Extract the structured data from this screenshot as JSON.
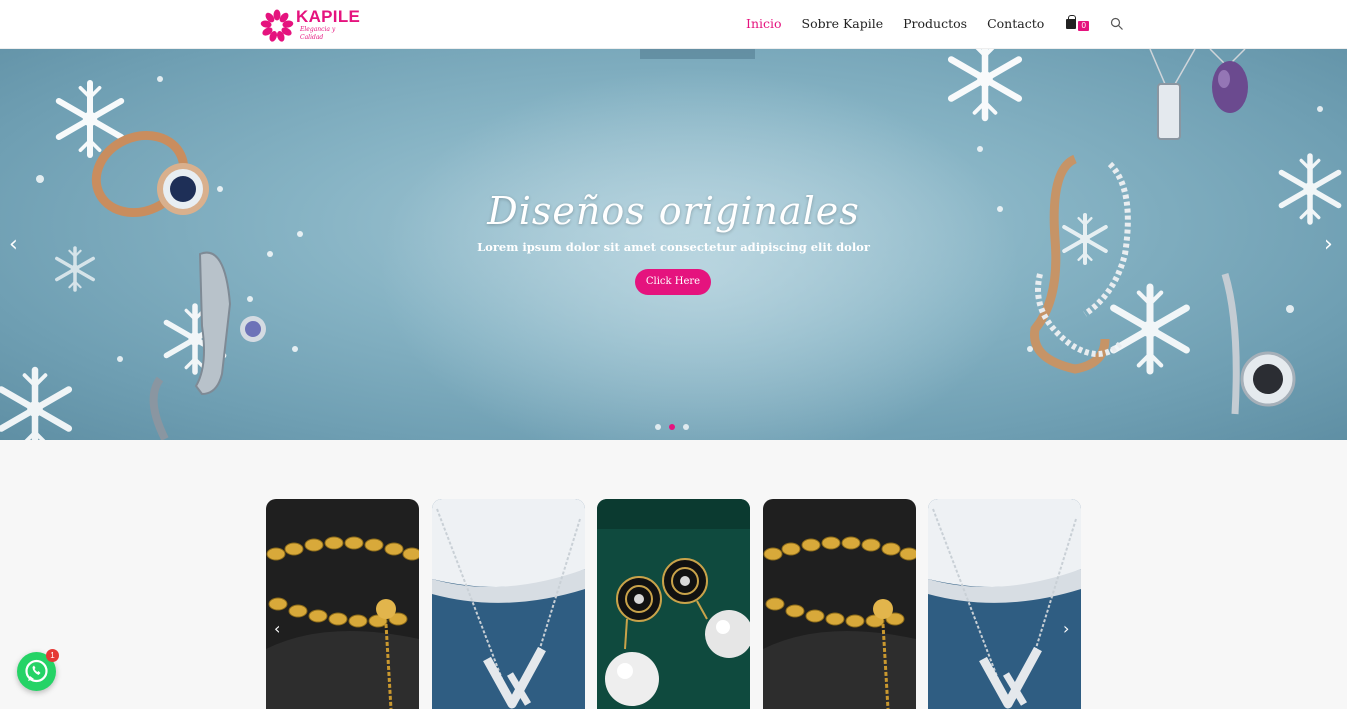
{
  "brand": {
    "name": "KAPILE",
    "tagline": "Elegancia y Calidad",
    "color": "#e5137e"
  },
  "nav": {
    "items": [
      {
        "label": "Inicio",
        "active": true
      },
      {
        "label": "Sobre Kapile",
        "active": false
      },
      {
        "label": "Productos",
        "active": false
      },
      {
        "label": "Contacto",
        "active": false
      }
    ],
    "cart_count": "0",
    "search_icon": "search-icon",
    "cart_icon": "shopping-bag-icon"
  },
  "hero": {
    "title": "Diseños originales",
    "subtitle": "Lorem ipsum dolor sit amet consectetur adipiscing elit dolor",
    "button_label": "Click Here",
    "prev_icon": "chevron-left-icon",
    "next_icon": "chevron-right-icon",
    "slide_count": 3,
    "active_slide": 2
  },
  "products": {
    "items": [
      {
        "image": "gold-bracelet"
      },
      {
        "image": "silver-v-necklace"
      },
      {
        "image": "flower-pearl-earrings"
      },
      {
        "image": "gold-bracelet"
      },
      {
        "image": "silver-v-necklace"
      }
    ]
  },
  "whatsapp": {
    "badge": "1",
    "icon": "whatsapp-icon"
  }
}
